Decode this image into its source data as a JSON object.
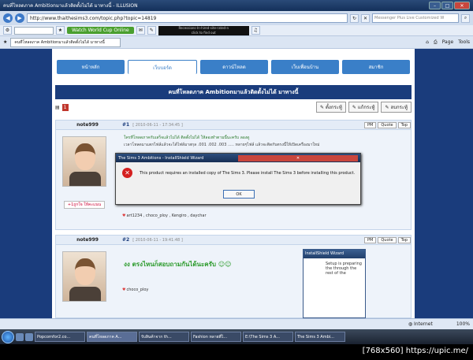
{
  "window": {
    "title": "คนที่โหลดภาค Ambitionมาแล้วติดตั้งไม่ได้ มาทางนี้ - ILLUSION"
  },
  "address": {
    "url": "http://www.thaithesims3.com/topic.php?topic=14819",
    "search_placeholder": "Messenger Plus Live Customized W"
  },
  "toolbar": {
    "world_cup": "Watch World Cup Online",
    "ad_line1": "Recessions-In-hired-site-rated-n",
    "ad_line2": "click to find out"
  },
  "tab": {
    "label": "คนที่โหลดภาค Ambitionมาแล้วติดตั้งไม่ได้ มาทางนี้",
    "page": "Page",
    "tools": "Tools"
  },
  "forum": {
    "nav": [
      "หน้าหลัก",
      "เว็บบอร์ด",
      "ดาวน์โหลด",
      "เว็บเพื่อนบ้าน",
      "สมาชิก"
    ],
    "topic_title": "คนที่โหลดภาค Ambitionมาแล้วติดตั้งไม่ได้ มาทางนี้",
    "page_num": "1",
    "actions": [
      "ตั้งกระทู้",
      "แก้กระทู้",
      "ลบกระทู้"
    ],
    "pm": "PM",
    "quote": "Quote",
    "top": "Top",
    "post1": {
      "author": "note999",
      "num": "#1",
      "date": "[ 2010-06-11 - 17:34:45 ]",
      "line1": "ใครที่โหลดภาคกับเสร็จแล้วไม่ได้ ติดตั้งไม่ได้ ให้ลองทำตามนี้นะครับ ลองดู",
      "line2": "เวลาโหลดมาแตกไฟล์แล้วจะได้ไฟล์มาสกุล .001 .002 .003 ..... หลายๆไฟล์ แล้วจะติดกับตรงนี้ให้เปิดเครื่องมาใหม่",
      "thanks_btn": "ถูกใจ ให้คะแนน",
      "thanks": "art1234 , choco_ploy , Kengiro , daychar"
    },
    "post2": {
      "author": "note999",
      "num": "#2",
      "date": "[ 2010-06-11 - 19:41:48 ]",
      "text": "งง ตรงไหนก็สอบถามกันได้นะครับ",
      "thanks": "choco_ploy"
    }
  },
  "installshield": {
    "title": "InstallShield Wizard",
    "text": "Setup is preparing the through the rest of the"
  },
  "dialog": {
    "title": "The Sims 3 Ambitions - InstallShield Wizard",
    "message": "This product requires an installed copy of The Sims 3. Please install The Sims 3 before installing this product.",
    "ok": "OK"
  },
  "status": {
    "zone": "Internet",
    "zoom": "100%"
  },
  "taskbar": {
    "items": [
      "Popcornfor2.co...",
      "คนที่โหลดภาค A...",
      "รับสินค้าจาก th...",
      "Fashion หลายพี่ไ...",
      "E:\\The Sims 3 A...",
      "The Sims 3 Ambi..."
    ]
  },
  "watermark": "[768x560] https://upic.me/"
}
